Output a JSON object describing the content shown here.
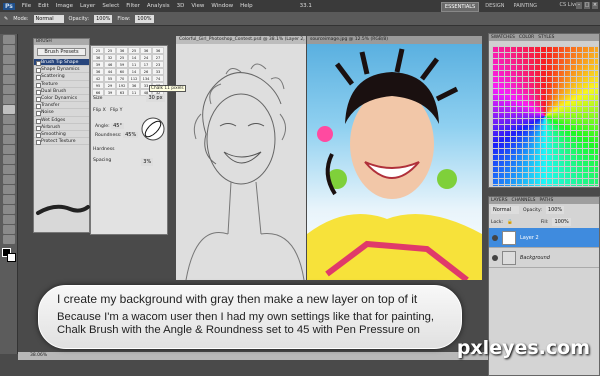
{
  "menubar": {
    "app_badge": "Ps",
    "items": [
      "File",
      "Edit",
      "Image",
      "Layer",
      "Select",
      "Filter",
      "Analysis",
      "3D",
      "View",
      "Window",
      "Help"
    ],
    "zoom": "33.1",
    "workspaces": [
      "ESSENTIALS",
      "DESIGN",
      "PAINTING"
    ],
    "cs_live": "CS Live"
  },
  "options": {
    "mode_label": "Mode:",
    "mode_value": "Normal",
    "opacity_label": "Opacity:",
    "opacity_value": "100%",
    "flow_label": "Flow:",
    "flow_value": "100%"
  },
  "doc_tabs": {
    "left": "Colorful_Girl_Photoshop_Contest.psd @ 38.1% (Layer 2, RGB/8#)",
    "right": "sourceimage.jpg @ 12.5% (RGB/8)"
  },
  "brush_panel": {
    "tabs": [
      "BRUSH",
      "BRUSH PRESETS"
    ],
    "presets_button": "Brush Presets",
    "options": [
      {
        "label": "Brush Tip Shape",
        "selected": true
      },
      {
        "label": "Shape Dynamics",
        "selected": false
      },
      {
        "label": "Scattering",
        "selected": false
      },
      {
        "label": "Texture",
        "selected": false
      },
      {
        "label": "Dual Brush",
        "selected": false
      },
      {
        "label": "Color Dynamics",
        "selected": false
      },
      {
        "label": "Transfer",
        "selected": false
      },
      {
        "label": "Noise",
        "selected": false
      },
      {
        "label": "Wet Edges",
        "selected": false
      },
      {
        "label": "Airbrush",
        "selected": false
      },
      {
        "label": "Smoothing",
        "selected": false
      },
      {
        "label": "Protect Texture",
        "selected": false
      }
    ],
    "tip_sizes": [
      "25",
      "25",
      "36",
      "25",
      "36",
      "36",
      "36",
      "32",
      "25",
      "14",
      "24",
      "27",
      "39",
      "46",
      "59",
      "11",
      "17",
      "23",
      "36",
      "44",
      "60",
      "14",
      "26",
      "33",
      "42",
      "55",
      "70",
      "112",
      "134",
      "74",
      "95",
      "29",
      "192",
      "36",
      "33",
      "63",
      "66",
      "39",
      "63",
      "11",
      "48",
      "32",
      "55",
      "100",
      "75",
      "45",
      "1106",
      "1106",
      "1106",
      "11"
    ],
    "tooltip": "Chalk 11 pixels",
    "size_label": "Size",
    "size_value": "30 px",
    "flip_x": "Flip X",
    "flip_y": "Flip Y",
    "angle_label": "Angle:",
    "angle_value": "45°",
    "roundness_label": "Roundness:",
    "roundness_value": "45%",
    "hardness_label": "Hardness",
    "spacing_label": "Spacing",
    "spacing_value": "3%"
  },
  "panels": {
    "swatches_tabs": [
      "SWATCHES",
      "COLOR",
      "STYLES"
    ],
    "layers_tabs": [
      "LAYERS",
      "CHANNELS",
      "PATHS"
    ],
    "blend_mode": "Normal",
    "opacity_label": "Opacity:",
    "opacity_value": "100%",
    "lock_label": "Lock:",
    "fill_label": "Fill:",
    "fill_value": "100%",
    "layers": [
      {
        "name": "Layer 2",
        "selected": true
      },
      {
        "name": "Background",
        "selected": false
      }
    ]
  },
  "status": {
    "zoom": "38.06%"
  },
  "caption": {
    "line1": "I create my background with gray then make a new layer on top of it",
    "line2": "Because I'm a wacom user then I had my own settings like that for painting, Chalk Brush with the Angle & Roundness set to 45 with Pen Pressure on"
  },
  "watermark": "pxleyes.com",
  "colors": {
    "accent": "#3f8bde",
    "ui_dark": "#3a3a3a",
    "selected_option": "#27457c"
  }
}
